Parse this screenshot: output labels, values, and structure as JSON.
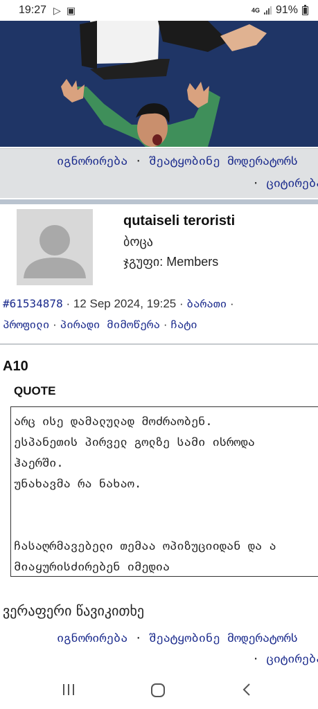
{
  "status_bar": {
    "time": "19:27",
    "network": "4G",
    "battery": "91%"
  },
  "actions": {
    "ignore": "იგნორირება",
    "report": "შეატყობინე მოდერატორს",
    "quote": "ციტირება",
    "separator": "·"
  },
  "profile": {
    "username": "qutaiseli teroristi",
    "rank": "ბოცა",
    "group_label": "ჯგუფი:",
    "group_value": "Members"
  },
  "post_meta": {
    "post_id": "#61534878",
    "date": "12 Sep 2024, 19:25",
    "links": [
      "ბარათი",
      "პროფილი",
      "პირადი მიმოწერა",
      "ჩატი"
    ]
  },
  "post": {
    "title": "A10",
    "quote_label": "QUOTE",
    "quote_lines": [
      "არც ისე დამალულად მოძრაობენ.",
      "ესპანეთის პირველ გოლზე სამი ისროდა",
      "ჰაერში.",
      "უნახავმა რა ნახაო.",
      "",
      "",
      "ჩასაღრმავებელი თემაა ოპიზუციიდან და ა",
      "მიაყურისძირებენ იმედია"
    ],
    "reply_text": "ვერაფერი წავიკითხე"
  },
  "colors": {
    "link": "#1a2a8c",
    "banner_bg": "#1f3566",
    "action_bar_bg": "#dfe1e3"
  }
}
